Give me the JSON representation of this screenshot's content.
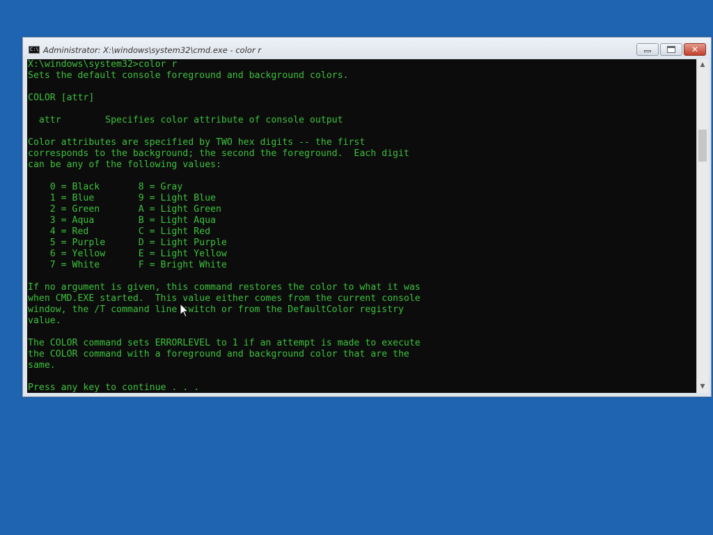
{
  "window": {
    "title": "Administrator: X:\\windows\\system32\\cmd.exe - color  r",
    "icon": "cmd-icon",
    "icon_text": "C:\\",
    "minimize_icon": "minimize-icon",
    "maximize_icon": "maximize-icon",
    "close_icon": "close-icon",
    "close_glyph": "✕"
  },
  "console": {
    "foreground": "#3ec13e",
    "background": "#0c0c0c",
    "lines": [
      "X:\\windows\\system32>color r",
      "Sets the default console foreground and background colors.",
      "",
      "COLOR [attr]",
      "",
      "  attr        Specifies color attribute of console output",
      "",
      "Color attributes are specified by TWO hex digits -- the first",
      "corresponds to the background; the second the foreground.  Each digit",
      "can be any of the following values:",
      "",
      "    0 = Black       8 = Gray",
      "    1 = Blue        9 = Light Blue",
      "    2 = Green       A = Light Green",
      "    3 = Aqua        B = Light Aqua",
      "    4 = Red         C = Light Red",
      "    5 = Purple      D = Light Purple",
      "    6 = Yellow      E = Light Yellow",
      "    7 = White       F = Bright White",
      "",
      "If no argument is given, this command restores the color to what it was",
      "when CMD.EXE started.  This value either comes from the current console",
      "window, the /T command line switch or from the DefaultColor registry",
      "value.",
      "",
      "The COLOR command sets ERRORLEVEL to 1 if an attempt is made to execute",
      "the COLOR command with a foreground and background color that are the",
      "same.",
      "",
      "Press any key to continue . . ."
    ]
  },
  "scrollbar": {
    "up_arrow": "▲",
    "down_arrow": "▼"
  },
  "colors": {
    "desktop": "#1f64b1",
    "close_button": "#c2402c"
  }
}
